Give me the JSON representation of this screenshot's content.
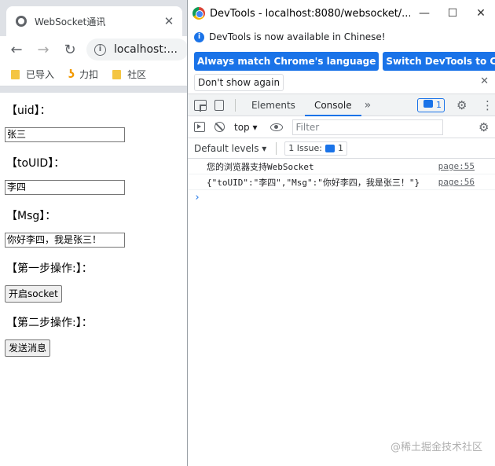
{
  "browser": {
    "tab_title": "WebSocket通讯",
    "tab_close": "✕",
    "url": "localhost:...",
    "bookmarks": [
      {
        "label": "已导入"
      },
      {
        "label": "力扣"
      },
      {
        "label": "社区"
      }
    ]
  },
  "page": {
    "uid_label": "【uid】：",
    "uid_value": "张三",
    "touid_label": "【toUID】：",
    "touid_value": "李四",
    "msg_label": "【Msg】：",
    "msg_value": "你好李四，我是张三！",
    "step1_label": "【第一步操作:】：",
    "open_socket_button": "开启socket",
    "step2_label": "【第二步操作:】：",
    "send_button": "发送消息"
  },
  "devtools": {
    "window_title": "DevTools - localhost:8080/websocket/...",
    "banner_text": "DevTools is now available in Chinese!",
    "banner_btn_match": "Always match Chrome's language",
    "banner_btn_switch": "Switch DevTools to Chinese",
    "banner_btn_dont": "Don't show again",
    "tabs": [
      "Elements",
      "Console"
    ],
    "active_tab": "Console",
    "issue_count": "1",
    "context": "top",
    "filter_placeholder": "Filter",
    "default_levels": "Default levels",
    "issues_label": "1 Issue:",
    "issues_count": "1",
    "messages": [
      {
        "text": "您的浏览器支持WebSocket",
        "source": "page:55"
      },
      {
        "text": "{\"toUID\":\"李四\",\"Msg\":\"你好李四，我是张三！\"}",
        "source": "page:56"
      }
    ],
    "prompt": "›"
  },
  "watermark": "@稀土掘金技术社区"
}
